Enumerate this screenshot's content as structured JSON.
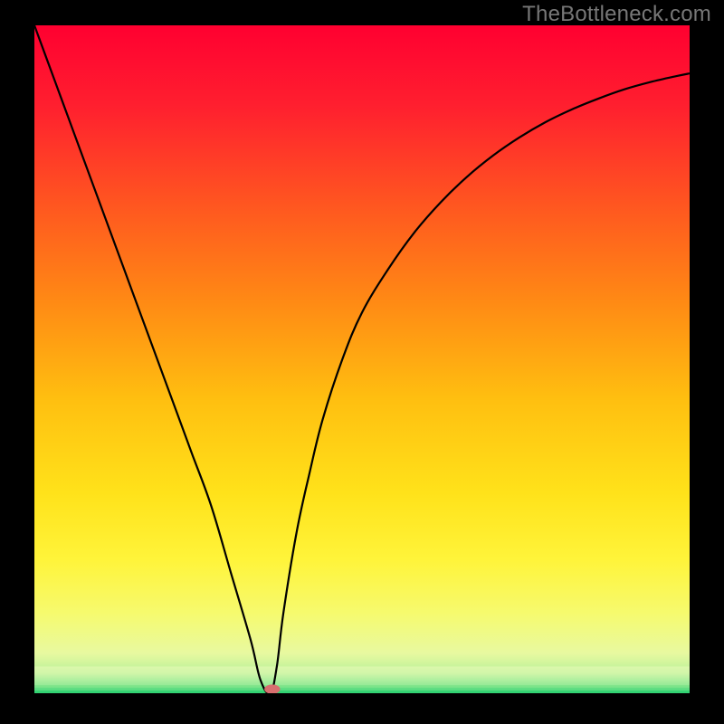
{
  "watermark": "TheBottleneck.com",
  "chart_data": {
    "type": "line",
    "title": "",
    "xlabel": "",
    "ylabel": "",
    "xlim": [
      0,
      100
    ],
    "ylim": [
      0,
      100
    ],
    "x": [
      0,
      3,
      6,
      9,
      12,
      15,
      18,
      21,
      24,
      27,
      30,
      33,
      34.5,
      36,
      37,
      38,
      40,
      42,
      44,
      47,
      50,
      54,
      58,
      62,
      66,
      70,
      74,
      78,
      82,
      86,
      90,
      94,
      98,
      100
    ],
    "values": [
      100,
      92,
      84,
      76,
      68,
      60,
      52,
      44,
      36,
      28,
      18,
      8,
      2,
      0,
      4,
      12,
      24,
      33,
      41,
      50,
      57,
      63.5,
      69,
      73.5,
      77.3,
      80.5,
      83.2,
      85.5,
      87.4,
      89.0,
      90.4,
      91.5,
      92.4,
      92.8
    ],
    "minimum_x": 36,
    "marker": {
      "x": 36.3,
      "y": 0.6,
      "rx": 1.2,
      "ry": 0.7,
      "color": "#d86f6f"
    },
    "bottom_band_breaks": [
      98.8,
      99.2,
      99.6,
      100
    ],
    "curve_color": "#000000",
    "gradient_stops": [
      {
        "offset": 0,
        "color": "#ff0030"
      },
      {
        "offset": 12,
        "color": "#ff1f2f"
      },
      {
        "offset": 28,
        "color": "#ff5a1f"
      },
      {
        "offset": 42,
        "color": "#ff8c14"
      },
      {
        "offset": 56,
        "color": "#ffbf10"
      },
      {
        "offset": 70,
        "color": "#ffe21a"
      },
      {
        "offset": 80,
        "color": "#fff43a"
      },
      {
        "offset": 88,
        "color": "#f6fa6e"
      },
      {
        "offset": 94,
        "color": "#e8f9a0"
      },
      {
        "offset": 97,
        "color": "#b9f199"
      },
      {
        "offset": 100,
        "color": "#20d36a"
      }
    ]
  }
}
